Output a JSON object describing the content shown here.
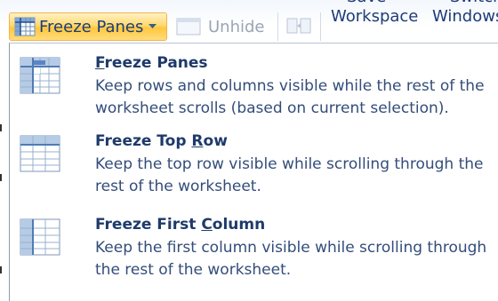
{
  "ribbon": {
    "freeze_panes_label": "Freeze Panes",
    "unhide_label": "Unhide",
    "save_workspace_line1": "Save",
    "save_workspace_line2": "Workspace",
    "switch_windows_line1": "Switch",
    "switch_windows_line2": "Windows"
  },
  "menu": {
    "items": [
      {
        "title_pre": "",
        "title_ul": "F",
        "title_post": "reeze Panes",
        "description": "Keep rows and columns visible while the rest of the worksheet scrolls (based on current selection).",
        "icon": "freeze-panes-icon"
      },
      {
        "title_pre": "Freeze Top ",
        "title_ul": "R",
        "title_post": "ow",
        "description": "Keep the top row visible while scrolling through the rest of the worksheet.",
        "icon": "freeze-top-row-icon"
      },
      {
        "title_pre": "Freeze First ",
        "title_ul": "C",
        "title_post": "olumn",
        "description": "Keep the first column visible while scrolling through the rest of the worksheet.",
        "icon": "freeze-first-column-icon"
      }
    ]
  },
  "colors": {
    "accent_hover": "#ffd96f",
    "title_text": "#1e3a6a",
    "desc_text": "#334d7a"
  }
}
